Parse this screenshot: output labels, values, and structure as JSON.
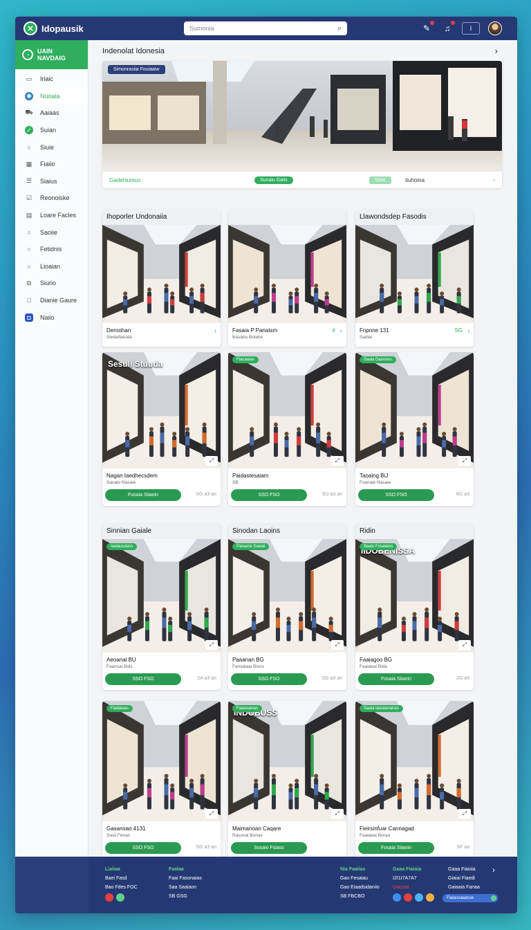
{
  "app": {
    "name": "Idopausik"
  },
  "search": {
    "placeholder": "Sumonia"
  },
  "topbar": {
    "box_label": "I"
  },
  "sidebar": {
    "brand_line1": "UAIN",
    "brand_line2": "NAVDAIG",
    "items": [
      {
        "label": "Iriaic",
        "icon": "monitor-icon"
      },
      {
        "label": "Nuoaia",
        "icon": "compass-icon"
      },
      {
        "label": "Aaiaas",
        "icon": "car-icon"
      },
      {
        "label": "Suian",
        "icon": "check-circle-icon"
      },
      {
        "label": "Siuie",
        "icon": "circle-icon"
      },
      {
        "label": "Fiaiio",
        "icon": "grid-icon"
      },
      {
        "label": "Siaius",
        "icon": "list-icon"
      },
      {
        "label": "Reonoiske",
        "icon": "check-square-icon"
      },
      {
        "label": "Loare Facles",
        "icon": "document-icon"
      },
      {
        "label": "Saoiie",
        "icon": "circle-icon"
      },
      {
        "label": "Fetidnis",
        "icon": "circle-icon"
      },
      {
        "label": "Lioaian",
        "icon": "circle-icon"
      },
      {
        "label": "Siurio",
        "icon": "sliders-icon"
      },
      {
        "label": "Dianie Gaure",
        "icon": "square-icon"
      },
      {
        "label": "Naiio",
        "icon": "shield-icon"
      }
    ]
  },
  "main": {
    "title": "Indenolat Idonesia",
    "hero": {
      "tag": "Simonrasiia Fouiaaiw",
      "left_link": "Gadehiuniuo",
      "pill": "Sunaiu Gaiis",
      "pill2": "Siaio",
      "right_text": "Iiuhoina"
    },
    "row1": [
      {
        "head": "Ihoporler Undonaiia",
        "t1": "Deroohan",
        "t2": "Siedaifaicala",
        "meta": ""
      },
      {
        "head": "",
        "t1": "Fasaia P Panatsm",
        "t2": "Basaria Bolahe",
        "meta": "#"
      },
      {
        "head": "Llawondsdep Fasodis",
        "t1": "Fnpone 131",
        "t2": "Sadiai",
        "meta": "SG"
      }
    ],
    "row2": [
      {
        "tag": "",
        "sign": "Sesull Stuuda",
        "t1": "Nagan Iaedhecsdem",
        "t2": "Sanaio Nasaie",
        "btn": "Fosaia Siiaoin",
        "meta": "SG a3 an"
      },
      {
        "tag": "Fiacaaias",
        "t1": "Paidastesaiam",
        "t2": "SB",
        "btn": "SSO FSO",
        "meta": "SU a3 an"
      },
      {
        "tag": "Saaia Dasnnes",
        "t1": "Taoaing BiJ",
        "t2": "Fsanaie Nasaie",
        "btn": "SSO FSO",
        "meta": "8G a3"
      }
    ],
    "row3": [
      {
        "head": "Sinnian Gaiale",
        "tag": "Iaaiausdans",
        "t1": "Aeoanal BU",
        "t2": "Faansai Bids",
        "btn": "SSO FSO",
        "meta": "2A a3 an"
      },
      {
        "head": "Sinodan Laoins",
        "tag": "Paioanis Saaial",
        "t1": "Paaanan BG",
        "t2": "Fansaiaai Bisns",
        "btn": "SSO FSO",
        "meta": "SG a3 an"
      },
      {
        "head": "Ridin",
        "tag": "Baaio Fosaieiss",
        "sign": "IIDOBENISSA",
        "t1": "Faaiagoo BG",
        "t2": "Faaiaeai Bida",
        "btn": "Fosaia Siiaoin",
        "meta": "2G a3"
      }
    ],
    "row4": [
      {
        "tag": "Faalaiaas",
        "t1": "Gasansao 4131",
        "t2": "Sasii Fenas",
        "btn": "SSO FSO",
        "meta": "SG a3 an"
      },
      {
        "tag": "Faaiasanas",
        "sign": "INDOBUSS",
        "t1": "Maimanoan Caqare",
        "t2": "Rassnai Bonas",
        "btn": "Sosaio Fsiass",
        "meta": ""
      },
      {
        "tag": "Saaia Iasiaiananas",
        "t1": "Fieirsinfuar Cannagad",
        "t2": "Faaiaeai Boraa",
        "btn": "Fosaia Siiaoin",
        "meta": "SF aa"
      }
    ]
  },
  "footer": {
    "col1": {
      "h": "Liaiiaa",
      "l2": "Baei Fasd",
      "l3": "Bao Fdes FOC"
    },
    "col2": {
      "h": "Faalaa",
      "l2": "Faai Fasonaias",
      "l3": "Saa Saaiaon",
      "l4": "SB GSG"
    },
    "col3": {
      "h": "Nia Faaiias",
      "l2": "Gao Fesaiau",
      "l3": "Gao Eiaadsidaniio",
      "l4": "SB FBCBO"
    },
    "col4": {
      "h": "Gaaa Fiaioia",
      "l2": "I2I1I7A7A7",
      "l3": "Giazsai",
      "l4": ""
    },
    "col5": {
      "h": "Gaaa Fiaioia",
      "l2": "Giaiai Fiaedi",
      "l3": "Gaiaaia Fanaa",
      "pill": "Fiaiausaaasue"
    }
  },
  "colors": {
    "accent": "#2fae5d",
    "navy": "#263873"
  }
}
